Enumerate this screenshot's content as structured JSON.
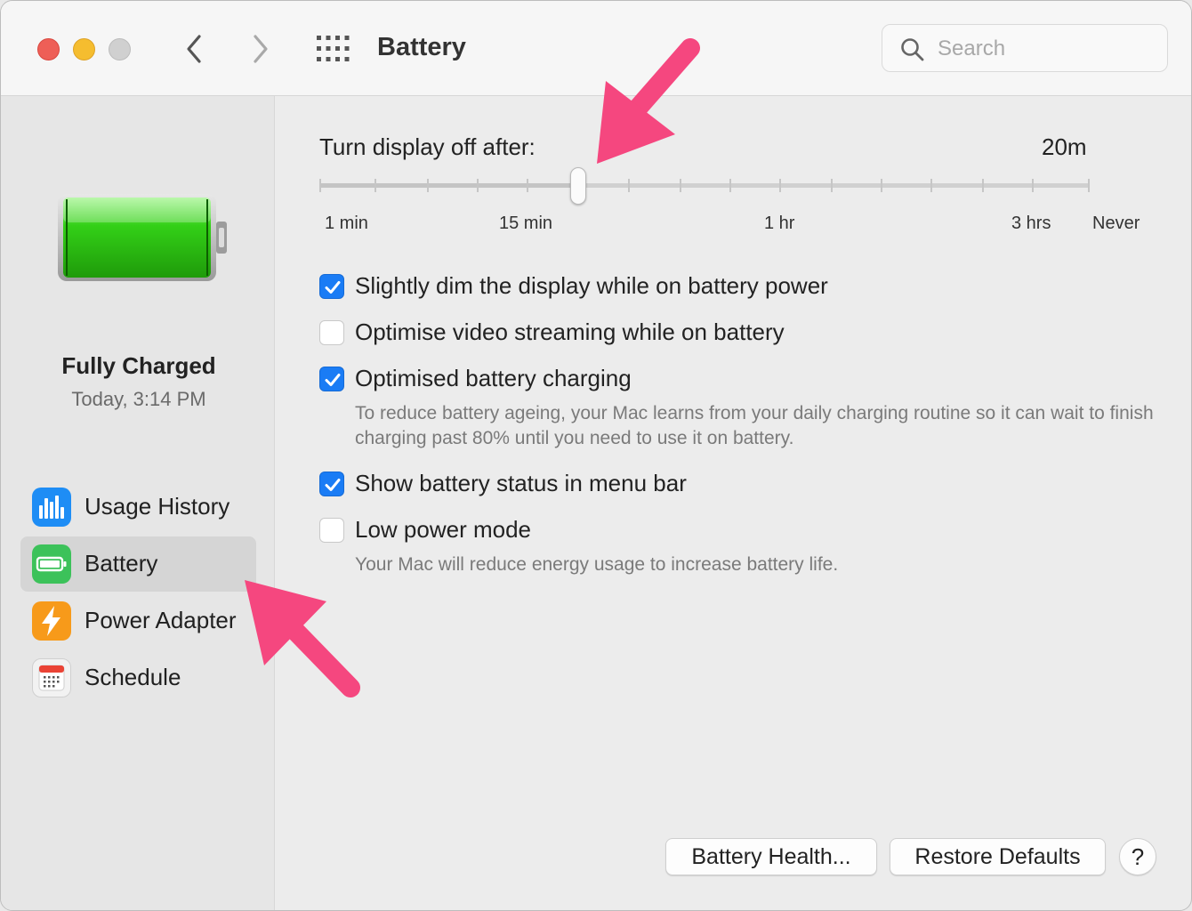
{
  "window": {
    "title": "Battery",
    "search_placeholder": "Search"
  },
  "icons": {
    "back": "chevron-left-icon",
    "forward": "chevron-right-icon",
    "grid": "grid-icon",
    "search": "search-icon"
  },
  "sidebar": {
    "status_title": "Fully Charged",
    "status_time": "Today, 3:14 PM",
    "items": [
      {
        "label": "Usage History",
        "icon": "usage-history-icon",
        "color": "#1e8df5",
        "selected": false
      },
      {
        "label": "Battery",
        "icon": "battery-icon",
        "color": "#3cc25a",
        "selected": true
      },
      {
        "label": "Power Adapter",
        "icon": "power-adapter-icon",
        "color": "#f79a1a",
        "selected": false
      },
      {
        "label": "Schedule",
        "icon": "calendar-icon",
        "color": "#f2f2f2",
        "selected": false
      }
    ]
  },
  "display_slider": {
    "label": "Turn display off after:",
    "value": "20m",
    "position_fraction": 0.336,
    "tick_labels": [
      "1 min",
      "15 min",
      "1 hr",
      "3 hrs",
      "Never"
    ]
  },
  "options": [
    {
      "label": "Slightly dim the display while on battery power",
      "checked": true
    },
    {
      "label": "Optimise video streaming while on battery",
      "checked": false
    },
    {
      "label": "Optimised battery charging",
      "checked": true,
      "description": "To reduce battery ageing, your Mac learns from your daily charging routine so it can wait to finish charging past 80% until you need to use it on battery."
    },
    {
      "label": "Show battery status in menu bar",
      "checked": true
    },
    {
      "label": "Low power mode",
      "checked": false,
      "description": "Your Mac will reduce energy usage to increase battery life."
    }
  ],
  "buttons": {
    "battery_health": "Battery Health...",
    "restore_defaults": "Restore Defaults",
    "help": "?"
  },
  "colors": {
    "accent": "#1a7cf5",
    "annotation_arrow": "#f5477f",
    "battery_fill": "#33d017"
  }
}
